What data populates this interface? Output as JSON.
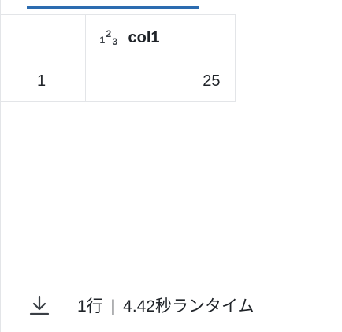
{
  "results": {
    "columns": [
      {
        "type_icon_digits": [
          "1",
          "2",
          "3"
        ],
        "name": "col1",
        "type_icon": "integer-type-icon"
      }
    ],
    "rows": [
      {
        "row_number": "1",
        "values": [
          "25"
        ]
      }
    ]
  },
  "footer": {
    "download_icon": "download-icon",
    "row_count": "1行",
    "separator": "|",
    "runtime": "4.42秒ランタイム"
  },
  "colors": {
    "accent": "#2c6cb0",
    "border": "#e3e5e8",
    "text": "#1f2328"
  }
}
